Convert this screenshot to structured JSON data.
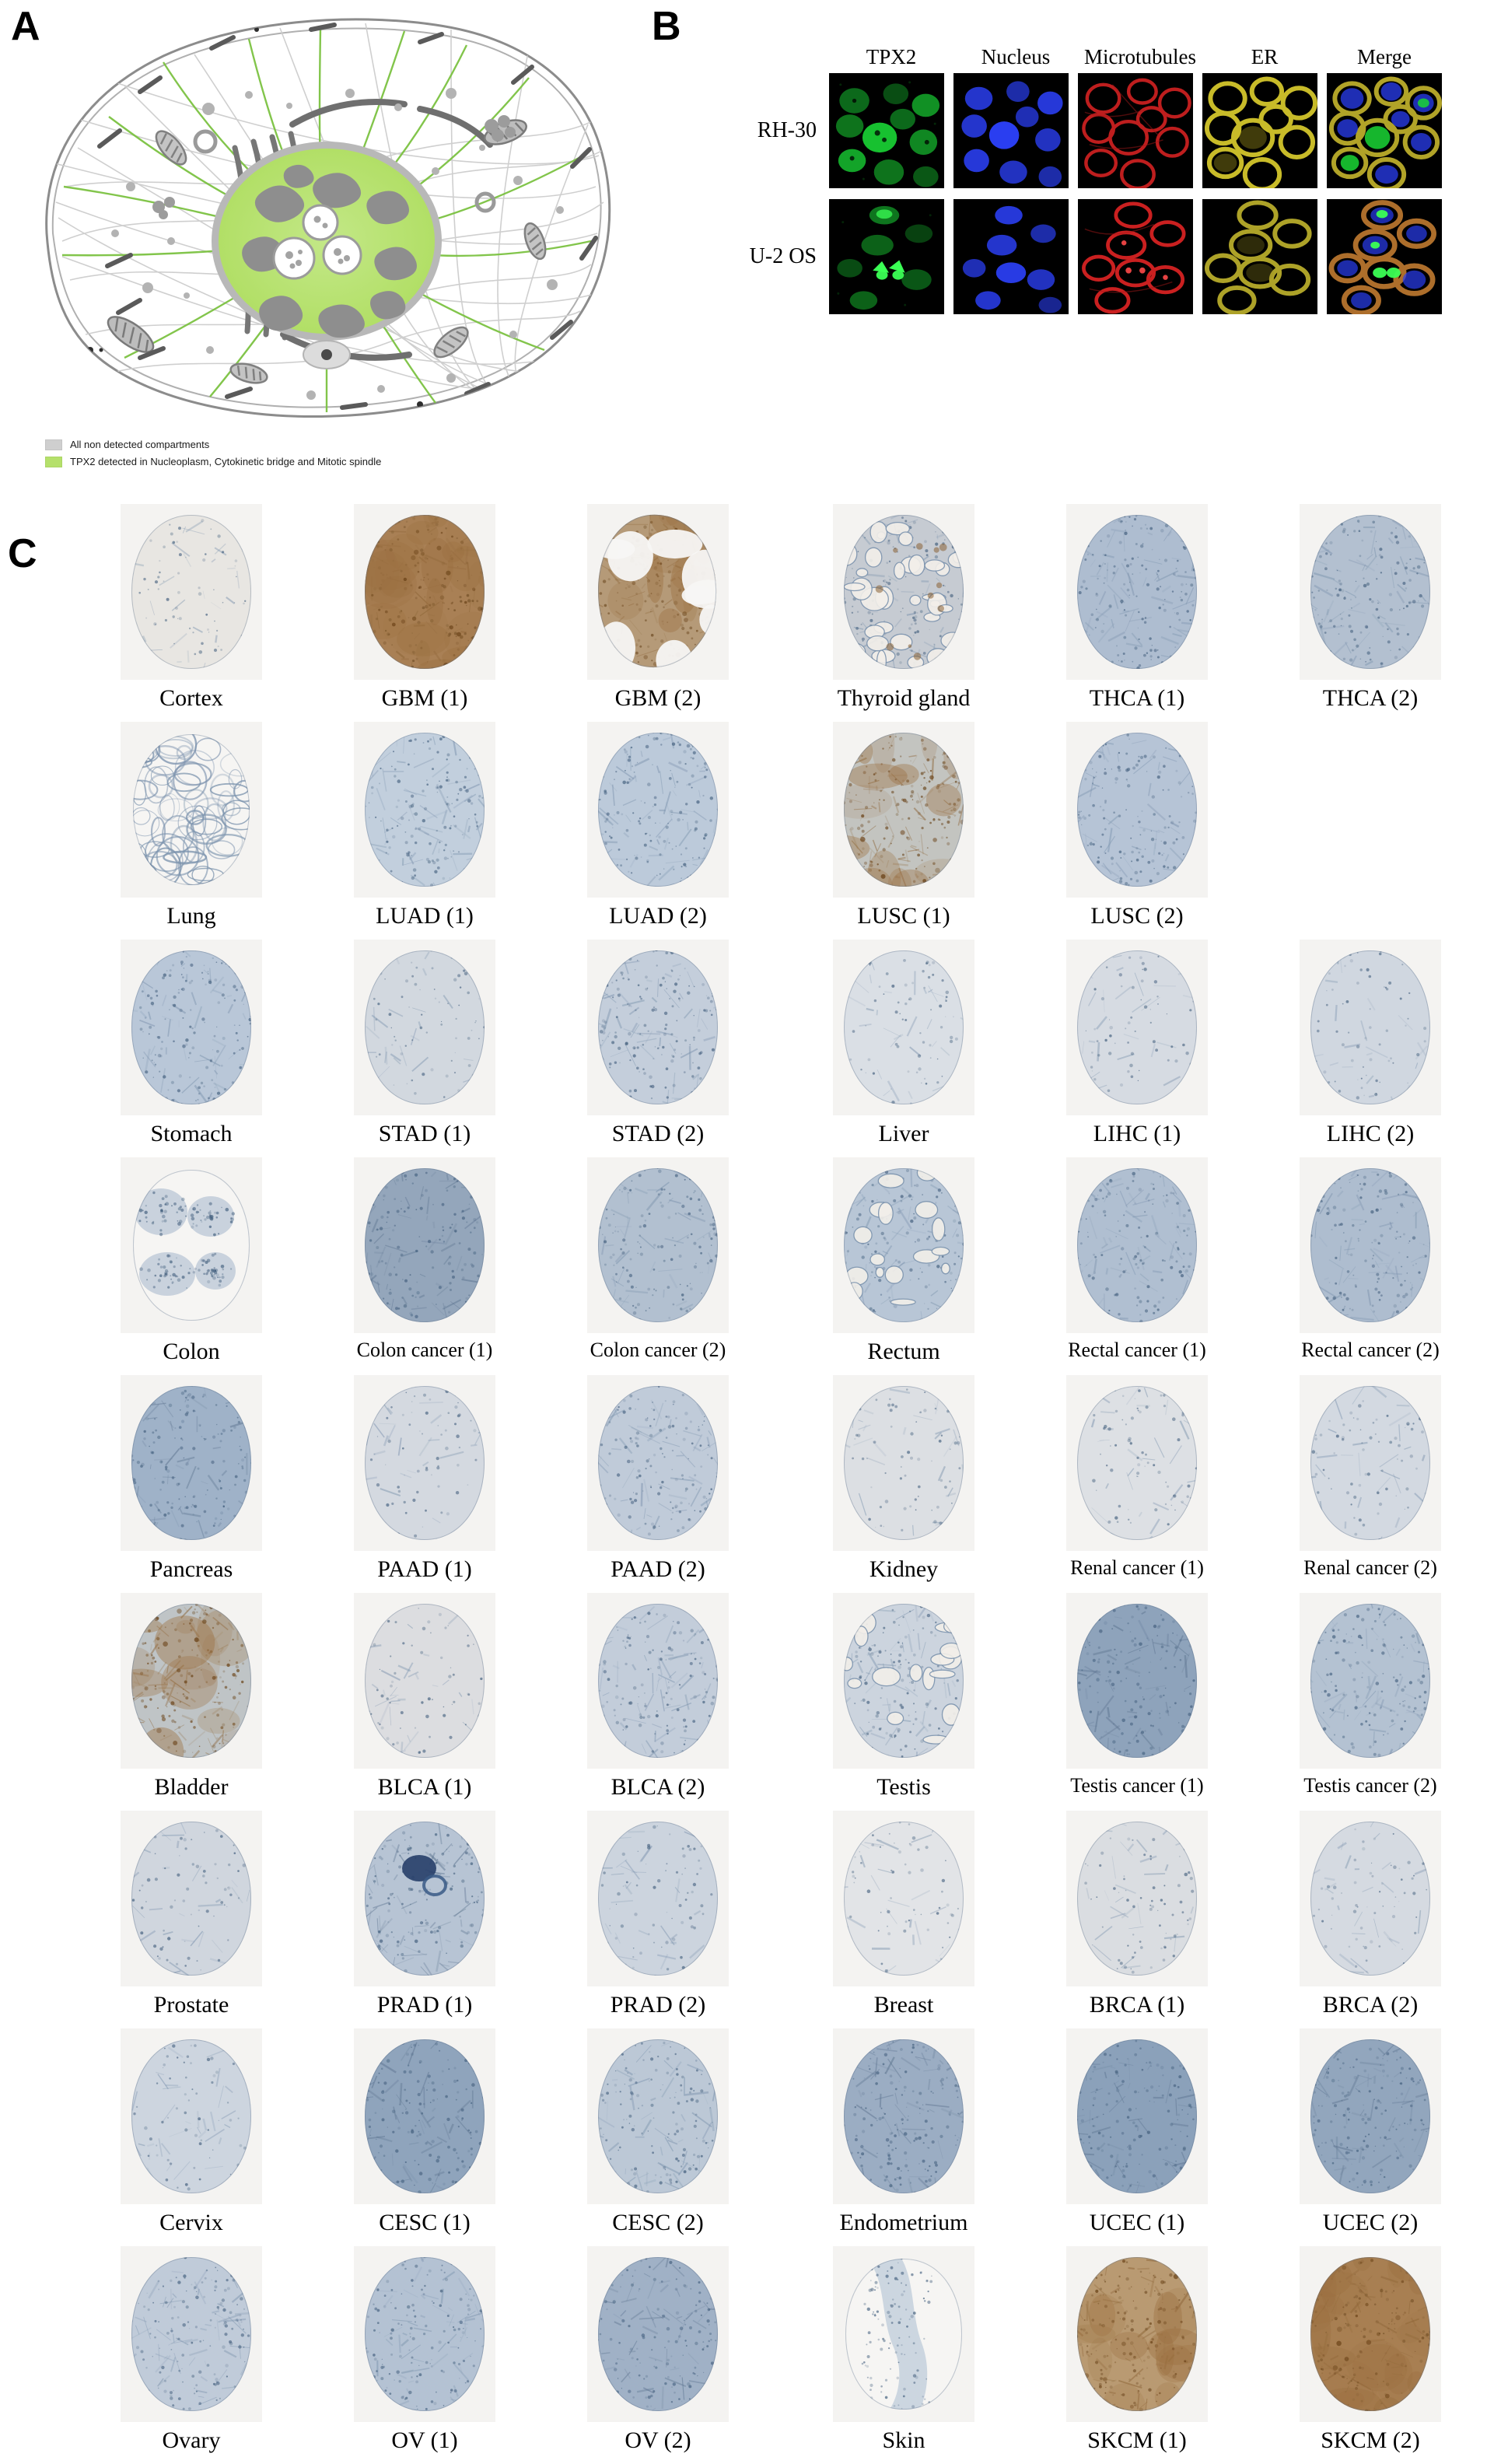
{
  "figure": {
    "panels": [
      {
        "letter": "A"
      },
      {
        "letter": "B"
      },
      {
        "letter": "C"
      }
    ]
  },
  "panel_a": {
    "letter": "A",
    "colors": {
      "not_detected": "#cfcfcf",
      "detected": "#b5e06b",
      "outline": "#8c8c8c",
      "organelle": "#8f8f8f",
      "microtubule": "#7cc242"
    },
    "legend": [
      {
        "swatch_color": "#cfcfcf",
        "label": "All non detected compartments",
        "swatch_name": "legend-swatch-not-detected"
      },
      {
        "swatch_color": "#b5e06b",
        "label": "TPX2 detected in Nucleoplasm, Cytokinetic bridge and Mitotic spindle",
        "swatch_name": "legend-swatch-detected"
      }
    ]
  },
  "panel_b": {
    "letter": "B",
    "columns": [
      "TPX2",
      "Nucleus",
      "Microtubules",
      "ER",
      "Merge"
    ],
    "rows": [
      {
        "label": "RH-30",
        "images": [
          {
            "channel": "TPX2",
            "color": "#18d23a"
          },
          {
            "channel": "Nucleus",
            "color": "#2030e8"
          },
          {
            "channel": "Microtubules",
            "color": "#d42020"
          },
          {
            "channel": "ER",
            "color": "#d8c828"
          },
          {
            "channel": "Merge",
            "color": "#c8b830"
          }
        ]
      },
      {
        "label": "U-2 OS",
        "images": [
          {
            "channel": "TPX2",
            "color": "#18d23a"
          },
          {
            "channel": "Nucleus",
            "color": "#2030e8"
          },
          {
            "channel": "Microtubules",
            "color": "#d42020"
          },
          {
            "channel": "ER",
            "color": "#c8b830"
          },
          {
            "channel": "Merge",
            "color": "#c07030"
          }
        ]
      }
    ]
  },
  "panel_c": {
    "letter": "C",
    "rows": [
      {
        "left": [
          {
            "label": "Cortex",
            "stain": "pale",
            "shape": "oval",
            "tint": "#e8e6e2"
          },
          {
            "label": "GBM (1)",
            "stain": "strong-brown",
            "shape": "oval",
            "tint": "#a98055"
          },
          {
            "label": "GBM (2)",
            "stain": "patchy-brown",
            "shape": "irregular",
            "tint": "#b59a78"
          }
        ],
        "right": [
          {
            "label": "Thyroid gland",
            "stain": "mixed",
            "shape": "oval",
            "tint": "#c6cbd2"
          },
          {
            "label": "THCA (1)",
            "stain": "blue",
            "shape": "oval",
            "tint": "#aebdd0"
          },
          {
            "label": "THCA (2)",
            "stain": "blue",
            "shape": "oval",
            "tint": "#b3c0d0"
          }
        ]
      },
      {
        "left": [
          {
            "label": "Lung",
            "stain": "sparse-blue",
            "shape": "lacy",
            "tint": "#cfd8e4"
          },
          {
            "label": "LUAD (1)",
            "stain": "blue",
            "shape": "oval",
            "tint": "#c2cfdd"
          },
          {
            "label": "LUAD (2)",
            "stain": "blue",
            "shape": "oval",
            "tint": "#bccada"
          }
        ],
        "right": [
          {
            "label": "LUSC (1)",
            "stain": "blue-brown",
            "shape": "oval",
            "tint": "#c3c4c0"
          },
          {
            "label": "LUSC (2)",
            "stain": "blue",
            "shape": "oval",
            "tint": "#b6c4d6"
          }
        ]
      },
      {
        "left": [
          {
            "label": "Stomach",
            "stain": "blue",
            "shape": "oval",
            "tint": "#b9c7d8"
          },
          {
            "label": "STAD (1)",
            "stain": "pale-blue",
            "shape": "oval",
            "tint": "#d2d8df"
          },
          {
            "label": "STAD (2)",
            "stain": "blue",
            "shape": "oval",
            "tint": "#c4cedb"
          }
        ],
        "right": [
          {
            "label": "Liver",
            "stain": "pale",
            "shape": "oval",
            "tint": "#dadfe5"
          },
          {
            "label": "LIHC (1)",
            "stain": "pale-blue",
            "shape": "oval",
            "tint": "#d6dbe2"
          },
          {
            "label": "LIHC (2)",
            "stain": "pale-blue",
            "shape": "oval",
            "tint": "#d0d7e0"
          }
        ]
      },
      {
        "left": [
          {
            "label": "Colon",
            "stain": "fragments",
            "shape": "fragments",
            "tint": "#c9d2dd"
          },
          {
            "label": "Colon cancer (1)",
            "stain": "dark-blue",
            "shape": "oval",
            "tint": "#94a6bb"
          },
          {
            "label": "Colon cancer (2)",
            "stain": "blue",
            "shape": "oval",
            "tint": "#b2c0d0"
          }
        ],
        "right": [
          {
            "label": "Rectum",
            "stain": "glandular",
            "shape": "oval",
            "tint": "#b8c6d6"
          },
          {
            "label": "Rectal cancer (1)",
            "stain": "blue",
            "shape": "oval",
            "tint": "#b0bfd1"
          },
          {
            "label": "Rectal cancer (2)",
            "stain": "blue",
            "shape": "oval",
            "tint": "#aebdcf"
          }
        ]
      },
      {
        "left": [
          {
            "label": "Pancreas",
            "stain": "dark-blue",
            "shape": "oval",
            "tint": "#9fb2c8"
          },
          {
            "label": "PAAD (1)",
            "stain": "pale-blue",
            "shape": "oval",
            "tint": "#d4d9e0"
          },
          {
            "label": "PAAD (2)",
            "stain": "blue",
            "shape": "oval",
            "tint": "#c0cbd9"
          }
        ],
        "right": [
          {
            "label": "Kidney",
            "stain": "pale",
            "shape": "oval",
            "tint": "#dcdfe3"
          },
          {
            "label": "Renal cancer (1)",
            "stain": "pale",
            "shape": "oval",
            "tint": "#dde0e4"
          },
          {
            "label": "Renal cancer (2)",
            "stain": "pale-blue",
            "shape": "oval",
            "tint": "#d3d9e1"
          }
        ]
      },
      {
        "left": [
          {
            "label": "Bladder",
            "stain": "blue-brown",
            "shape": "oval",
            "tint": "#bfc4c6"
          },
          {
            "label": "BLCA (1)",
            "stain": "pale",
            "shape": "oval",
            "tint": "#dcdde0"
          },
          {
            "label": "BLCA (2)",
            "stain": "blue",
            "shape": "oval",
            "tint": "#c3cdda"
          }
        ],
        "right": [
          {
            "label": "Testis",
            "stain": "glandular",
            "shape": "oval",
            "tint": "#ccd4de"
          },
          {
            "label": "Testis cancer (1)",
            "stain": "dark-blue",
            "shape": "oval",
            "tint": "#8ea3bb"
          },
          {
            "label": "Testis cancer (2)",
            "stain": "blue",
            "shape": "oval",
            "tint": "#b4c2d2"
          }
        ]
      },
      {
        "left": [
          {
            "label": "Prostate",
            "stain": "pale-blue",
            "shape": "oval",
            "tint": "#d0d6de"
          },
          {
            "label": "PRAD (1)",
            "stain": "dark-spot",
            "shape": "oval",
            "tint": "#b7c4d4"
          },
          {
            "label": "PRAD (2)",
            "stain": "pale-blue",
            "shape": "oval",
            "tint": "#ccd4de"
          }
        ],
        "right": [
          {
            "label": "Breast",
            "stain": "very-pale",
            "shape": "oval",
            "tint": "#e2e4e7"
          },
          {
            "label": "BRCA (1)",
            "stain": "pale",
            "shape": "oval",
            "tint": "#dadde1"
          },
          {
            "label": "BRCA (2)",
            "stain": "pale-blue",
            "shape": "oval",
            "tint": "#d5dae1"
          }
        ]
      },
      {
        "left": [
          {
            "label": "Cervix",
            "stain": "pale-blue",
            "shape": "oval",
            "tint": "#cdd5df"
          },
          {
            "label": "CESC (1)",
            "stain": "dark-blue",
            "shape": "oval",
            "tint": "#8fa4bc"
          },
          {
            "label": "CESC (2)",
            "stain": "blue",
            "shape": "oval",
            "tint": "#bcc8d6"
          }
        ],
        "right": [
          {
            "label": "Endometrium",
            "stain": "dark-blue",
            "shape": "oval",
            "tint": "#9badc3"
          },
          {
            "label": "UCEC (1)",
            "stain": "dark-blue",
            "shape": "oval",
            "tint": "#8ba1ba"
          },
          {
            "label": "UCEC (2)",
            "stain": "dark-blue",
            "shape": "oval",
            "tint": "#92a6bd"
          }
        ]
      },
      {
        "left": [
          {
            "label": "Ovary",
            "stain": "blue",
            "shape": "oval",
            "tint": "#c0cbd9"
          },
          {
            "label": "OV (1)",
            "stain": "blue",
            "shape": "oval",
            "tint": "#b4c2d3"
          },
          {
            "label": "OV (2)",
            "stain": "dark-blue",
            "shape": "oval",
            "tint": "#a0b1c6"
          }
        ],
        "right": [
          {
            "label": "Skin",
            "stain": "pale-blue",
            "shape": "strip",
            "tint": "#ccd6e0"
          },
          {
            "label": "SKCM (1)",
            "stain": "brown",
            "shape": "oval",
            "tint": "#b99a72"
          },
          {
            "label": "SKCM (2)",
            "stain": "strong-brown",
            "shape": "oval",
            "tint": "#a87f52"
          }
        ]
      }
    ]
  }
}
